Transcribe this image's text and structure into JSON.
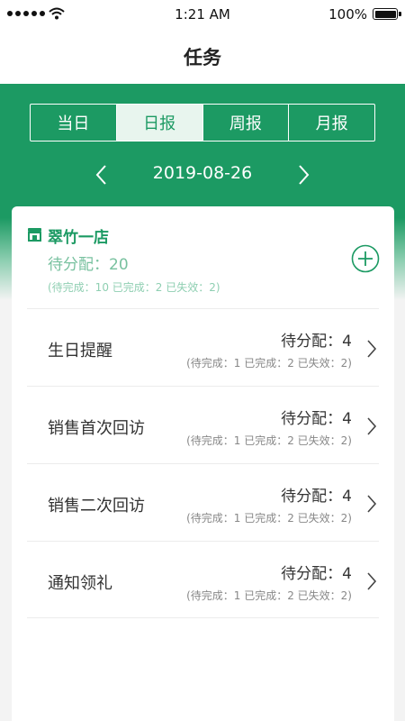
{
  "status_bar": {
    "time": "1:21 AM",
    "battery": "100%",
    "battery_level": 1.0,
    "signal_icon": "signal-dots-icon",
    "wifi_icon": "wifi-icon"
  },
  "nav": {
    "title": "任务"
  },
  "tabs": [
    {
      "label": "当日",
      "active": false
    },
    {
      "label": "日报",
      "active": true
    },
    {
      "label": "周报",
      "active": false
    },
    {
      "label": "月报",
      "active": false
    }
  ],
  "date": {
    "value": "2019-08-26",
    "prev_icon": "chevron-left-icon",
    "next_icon": "chevron-right-icon"
  },
  "store": {
    "name": "翠竹一店",
    "pending": "待分配：20",
    "summary": "(待完成：10  已完成：2  已失效：2)",
    "icon": "store-icon",
    "add_icon": "plus-circle-icon"
  },
  "tasks": [
    {
      "name": "生日提醒",
      "pending": "待分配：4",
      "summary": "(待完成：1  已完成：2  已失效：2)"
    },
    {
      "name": "销售首次回访",
      "pending": "待分配：4",
      "summary": "(待完成：1  已完成：2  已失效：2)"
    },
    {
      "name": "销售二次回访",
      "pending": "待分配：4",
      "summary": "(待完成：1  已完成：2  已失效：2)"
    },
    {
      "name": "通知领礼",
      "pending": "待分配：4",
      "summary": "(待完成：1  已完成：2  已失效：2)"
    }
  ],
  "colors": {
    "brand_green": "#1c9a63",
    "light_green": "#78c19f",
    "tab_active_bg": "#e8f5ee"
  }
}
